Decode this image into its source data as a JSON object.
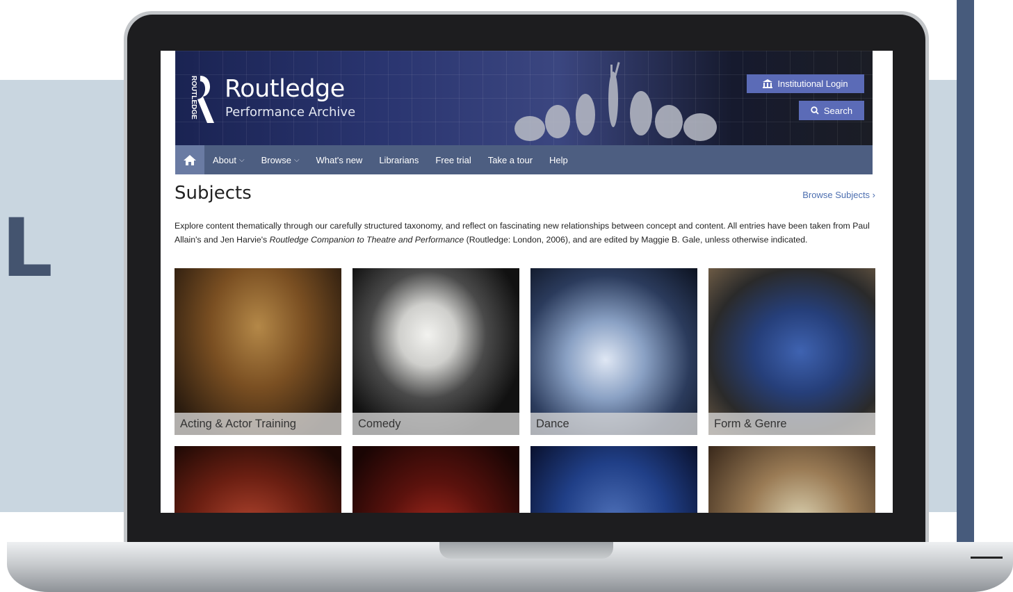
{
  "background": {
    "letter": "L"
  },
  "header": {
    "brand_title": "Routledge",
    "brand_subtitle": "Performance Archive",
    "brand_vertical": "ROUTLEDGE",
    "login_label": "Institutional Login",
    "search_label": "Search"
  },
  "nav": {
    "items": [
      {
        "label": "About",
        "has_dropdown": true
      },
      {
        "label": "Browse",
        "has_dropdown": true
      },
      {
        "label": "What's new"
      },
      {
        "label": "Librarians"
      },
      {
        "label": "Free trial"
      },
      {
        "label": "Take a tour"
      },
      {
        "label": "Help"
      }
    ]
  },
  "page": {
    "title": "Subjects",
    "browse_link": "Browse Subjects ›",
    "intro_1": "Explore content thematically through our carefully structured taxonomy, and reflect on fascinating new relationships between concept and content. All entries have been taken from Paul Allain's and Jen Harvie's ",
    "intro_italic": "Routledge Companion to Theatre and Performance",
    "intro_2": " (Routledge: London, 2006), and are edited by Maggie B. Gale, unless otherwise indicated."
  },
  "subjects": [
    {
      "label": "Acting & Actor Training"
    },
    {
      "label": "Comedy"
    },
    {
      "label": "Dance"
    },
    {
      "label": "Form & Genre"
    }
  ],
  "colors": {
    "nav_bg": "#4d5e81",
    "button_bg": "#5b6bb7",
    "link": "#4d6fb0"
  }
}
